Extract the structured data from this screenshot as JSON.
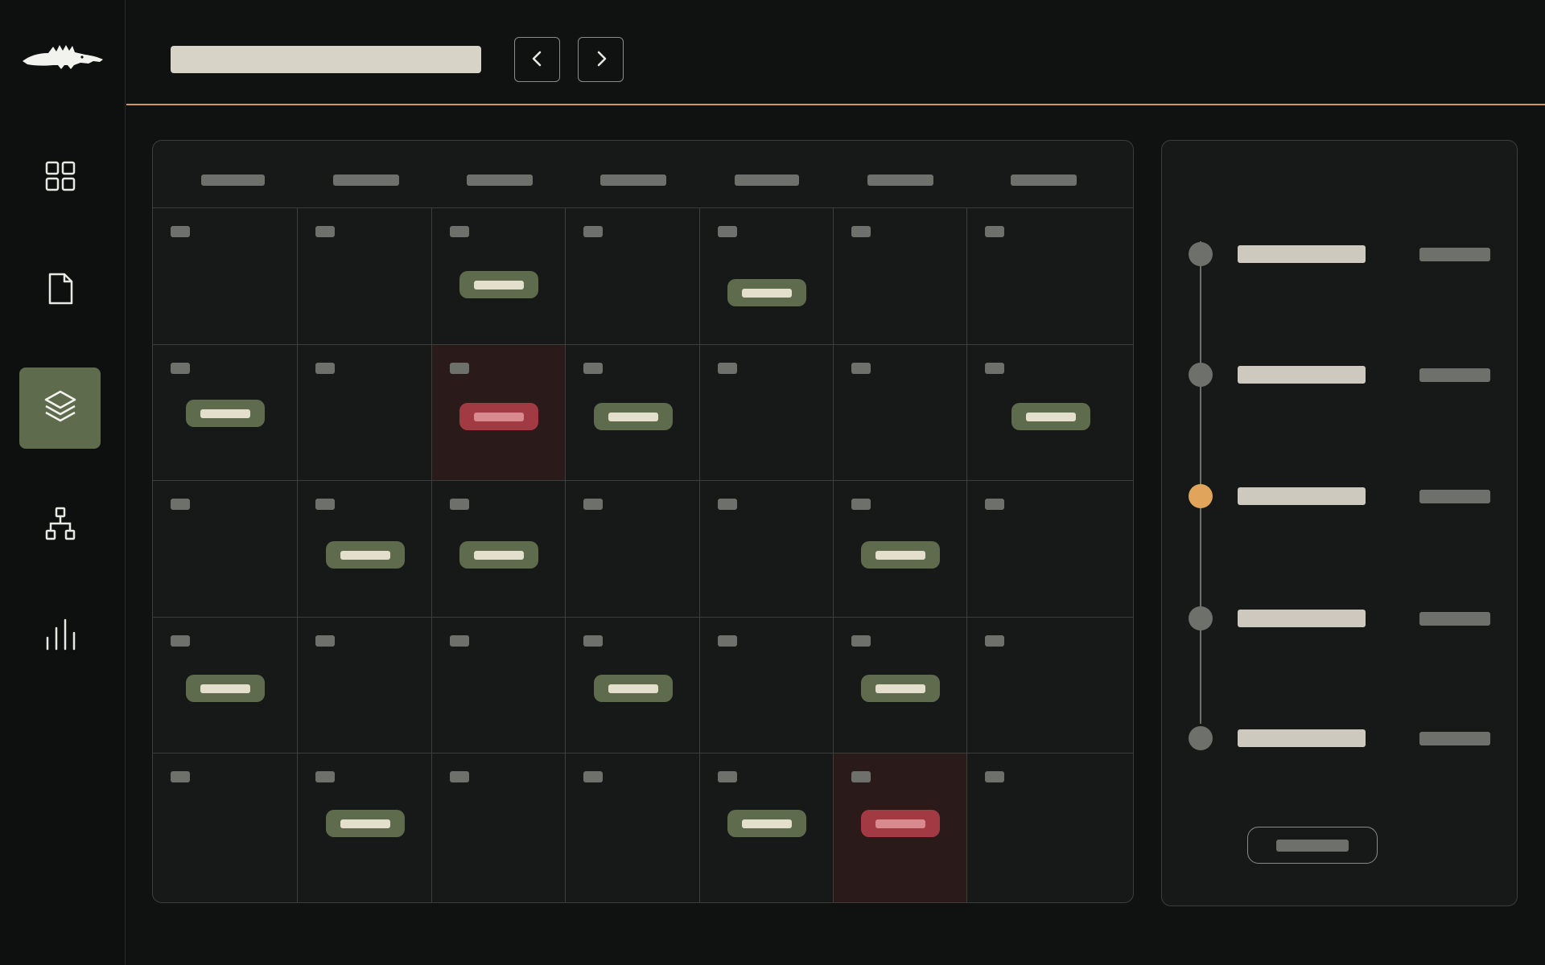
{
  "sidebar": {
    "logo_icon": "crocodile-logo-icon",
    "items": [
      {
        "id": "dashboard",
        "icon": "grid-icon",
        "active": false
      },
      {
        "id": "documents",
        "icon": "document-icon",
        "active": false
      },
      {
        "id": "layers",
        "icon": "layers-icon",
        "active": true
      },
      {
        "id": "hierarchy",
        "icon": "org-chart-icon",
        "active": false
      },
      {
        "id": "analytics",
        "icon": "bar-chart-icon",
        "active": false
      }
    ]
  },
  "toolbar": {
    "title": "",
    "prev_icon": "chevron-left-icon",
    "next_icon": "chevron-right-icon"
  },
  "calendar": {
    "weekday_headers": [
      "",
      "",
      "",
      "",
      "",
      "",
      ""
    ],
    "weeks": [
      [
        {
          "event": null
        },
        {
          "event": null
        },
        {
          "event": "normal"
        },
        {
          "event": null
        },
        {
          "event": "normal"
        },
        {
          "event": null
        },
        {
          "event": null
        }
      ],
      [
        {
          "event": "normal"
        },
        {
          "event": null
        },
        {
          "event": "alert",
          "highlight": true
        },
        {
          "event": "normal"
        },
        {
          "event": null
        },
        {
          "event": null
        },
        {
          "event": "normal"
        }
      ],
      [
        {
          "event": null
        },
        {
          "event": "normal"
        },
        {
          "event": "normal"
        },
        {
          "event": null
        },
        {
          "event": null
        },
        {
          "event": "normal"
        },
        {
          "event": null
        }
      ],
      [
        {
          "event": "normal"
        },
        {
          "event": null
        },
        {
          "event": null
        },
        {
          "event": "normal"
        },
        {
          "event": null
        },
        {
          "event": "normal"
        },
        {
          "event": null
        }
      ],
      [
        {
          "event": null
        },
        {
          "event": "normal"
        },
        {
          "event": null
        },
        {
          "event": null
        },
        {
          "event": "normal"
        },
        {
          "event": "alert",
          "highlight": true
        },
        {
          "event": null
        }
      ]
    ]
  },
  "timeline": {
    "items": [
      {
        "label": "",
        "meta": "",
        "state": "default"
      },
      {
        "label": "",
        "meta": "",
        "state": "default"
      },
      {
        "label": "",
        "meta": "",
        "state": "current"
      },
      {
        "label": "",
        "meta": "",
        "state": "default"
      },
      {
        "label": "",
        "meta": "",
        "state": "default"
      }
    ],
    "action_label": ""
  },
  "colors": {
    "accent": "#e0a45a",
    "event_normal": "#5e6b4c",
    "event_alert": "#a13a42",
    "active_nav": "#5e6b4c"
  }
}
